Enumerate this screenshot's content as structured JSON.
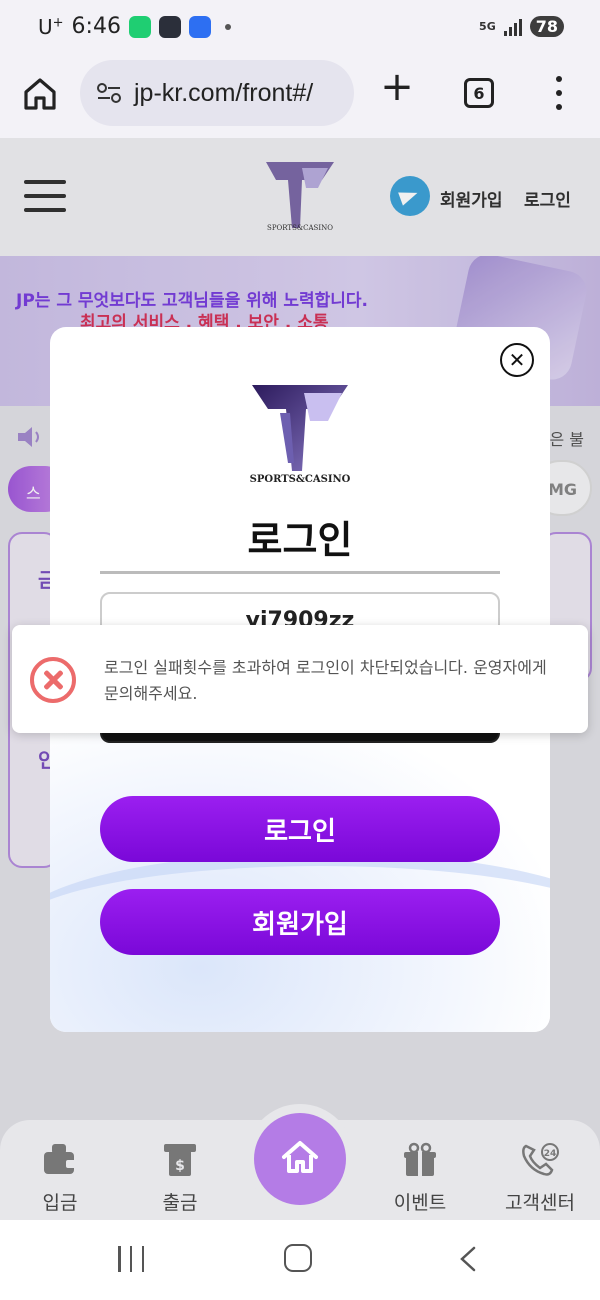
{
  "status_bar": {
    "carrier": "U",
    "carrier_sup": "+",
    "time": "6:46",
    "app_icons": [
      "shopping-app-icon",
      "wear-app-icon",
      "social-app-icon"
    ],
    "network": "5G",
    "battery": "78"
  },
  "browser": {
    "url": "jp-kr.com/front#/",
    "tab_count": "6"
  },
  "site": {
    "logo_text": "SPORTS&CASINO",
    "signup_link": "회원가입",
    "login_link": "로그인",
    "banner_line1": "JP는 그 무엇보다도 고객님들을 위해 노력합니다.",
    "banner_line2": "최고의 서비스 . 혜택 . 보안 . 소통",
    "ticker_fragment": "은 불",
    "pill_left": "스",
    "pill_right": "MG",
    "card_fragment_1": "금",
    "card_fragment_2": "인"
  },
  "modal": {
    "logo_text": "SPORTS&CASINO",
    "title": "로그인",
    "username_value": "yj7909zz",
    "login_button": "로그인",
    "signup_button": "회원가입"
  },
  "toast": {
    "message": "로그인 실패횟수를 초과하여 로그인이 차단되었습니다. 운영자에게 문의해주세요."
  },
  "bottom_nav": {
    "items": [
      {
        "label": "입금",
        "icon": "wallet-icon"
      },
      {
        "label": "출금",
        "icon": "withdraw-icon"
      },
      {
        "label": "",
        "icon": "home-icon"
      },
      {
        "label": "이벤트",
        "icon": "gift-icon"
      },
      {
        "label": "고객센터",
        "icon": "support-24-icon"
      }
    ]
  },
  "colors": {
    "accent_purple": "#8a12e6",
    "error_red": "#ec6b6b",
    "home_circle": "#b47ce6"
  }
}
